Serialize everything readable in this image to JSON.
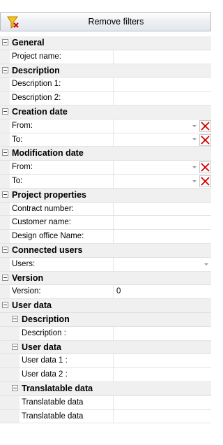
{
  "toolbar": {
    "remove_filters_label": "Remove filters"
  },
  "icons": {
    "funnel": "filter-remove-icon",
    "clear": "close-icon",
    "dropdown": "chevron-down-icon",
    "toggle": "minus-icon"
  },
  "colors": {
    "clear_x": "#d40000",
    "category_bg": "#f0f0f0",
    "grid_line": "#e4e4e4"
  },
  "sections": {
    "general": {
      "title": "General",
      "project_name": "Project name:"
    },
    "description": {
      "title": "Description",
      "description_1": "Description 1:",
      "description_2": "Description 2:"
    },
    "creation_date": {
      "title": "Creation date",
      "from": "From:",
      "to": "To:"
    },
    "modification_date": {
      "title": "Modification date",
      "from": "From:",
      "to": "To:"
    },
    "project_properties": {
      "title": "Project properties",
      "contract_number": "Contract number:",
      "customer_name": "Customer name:",
      "design_office_name": "Design office Name:"
    },
    "connected_users": {
      "title": "Connected users",
      "users": "Users:"
    },
    "version": {
      "title": "Version",
      "version_label": "Version:",
      "version_value": "0"
    },
    "user_data": {
      "title": "User data",
      "description": {
        "title": "Description",
        "description_label": "Description :"
      },
      "user_data_group": {
        "title": "User data",
        "user_data_1": "User data 1 :",
        "user_data_2": "User data 2 :"
      },
      "translatable_data": {
        "title": "Translatable data",
        "item_1": "Translatable data",
        "item_2": "Translatable data"
      }
    }
  }
}
